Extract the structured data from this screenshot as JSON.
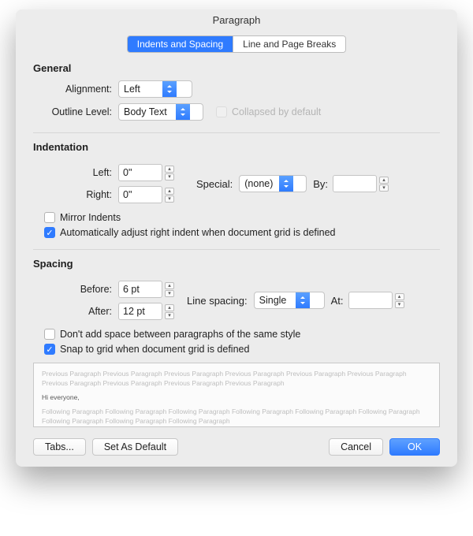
{
  "title": "Paragraph",
  "tabs": {
    "active": "Indents and Spacing",
    "inactive": "Line and Page Breaks"
  },
  "general": {
    "heading": "General",
    "alignment_label": "Alignment:",
    "alignment_value": "Left",
    "outline_label": "Outline Level:",
    "outline_value": "Body Text",
    "collapsed_label": "Collapsed by default"
  },
  "indentation": {
    "heading": "Indentation",
    "left_label": "Left:",
    "left_value": "0\"",
    "right_label": "Right:",
    "right_value": "0\"",
    "special_label": "Special:",
    "special_value": "(none)",
    "by_label": "By:",
    "by_value": "",
    "mirror_label": "Mirror Indents",
    "auto_adjust_label": "Automatically adjust right indent when document grid is defined"
  },
  "spacing": {
    "heading": "Spacing",
    "before_label": "Before:",
    "before_value": "6 pt",
    "after_label": "After:",
    "after_value": "12 pt",
    "line_label": "Line spacing:",
    "line_value": "Single",
    "at_label": "At:",
    "at_value": "",
    "dont_add_label": "Don't add space between paragraphs of the same style",
    "snap_label": "Snap to grid when document grid is defined"
  },
  "preview": {
    "prev": "Previous Paragraph Previous Paragraph Previous Paragraph Previous Paragraph Previous Paragraph Previous Paragraph Previous Paragraph Previous Paragraph Previous Paragraph Previous Paragraph",
    "sample": "Hi everyone,",
    "next": "Following Paragraph Following Paragraph Following Paragraph Following Paragraph Following Paragraph Following Paragraph Following Paragraph Following Paragraph Following Paragraph"
  },
  "buttons": {
    "tabs": "Tabs...",
    "set_default": "Set As Default",
    "cancel": "Cancel",
    "ok": "OK"
  }
}
